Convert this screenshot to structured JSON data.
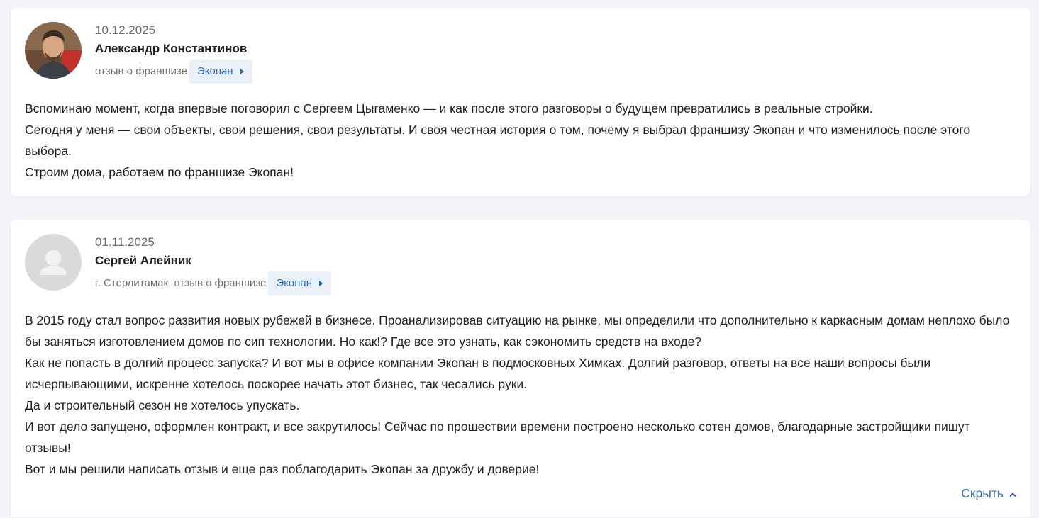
{
  "reviews": [
    {
      "date": "10.12.2025",
      "author": "Александр Константинов",
      "subline": "отзыв о франшизе",
      "brand": "Экопан",
      "paragraphs": [
        "Вспоминаю момент, когда впервые поговорил с Сергеем Цыгаменко — и как после этого разговоры о будущем превратились в реальные стройки.",
        "Сегодня у меня — свои объекты, свои решения, свои результаты. И своя честная история о том, почему я выбрал франшизу Экопан и что изменилось после этого выбора.",
        "Строим дома, работаем по франшизе Экопан!"
      ],
      "avatar_icon": "user-photo"
    },
    {
      "date": "01.11.2025",
      "author": "Сергей Алейник",
      "subline": "г. Стерлитамак, отзыв о франшизе",
      "brand": "Экопан",
      "paragraphs": [
        "В 2015 году стал вопрос развития новых рубежей в бизнесе. Проанализировав ситуацию на рынке, мы определили что дополнительно к каркасным домам неплохо было бы заняться изготовлением домов по сип технологии. Но как!? Где все это узнать, как сэкономить средств на входе?",
        "Как не попасть в долгий процесс запуска? И вот мы в офисе компании Экопан в подмосковных Химках.  Долгий разговор, ответы на все наши вопросы были исчерпывающими, искренне хотелось поскорее начать этот бизнес, так чесались руки.",
        "Да и строительный сезон не хотелось упускать.",
        "И вот дело запущено, оформлен контракт, и все закрутилось! Сейчас по прошествии времени построено  несколько сотен домов, благодарные застройщики пишут отзывы!",
        "Вот и мы решили написать отзыв и еще раз поблагодарить Экопан за дружбу и доверие!"
      ],
      "avatar_icon": "default-user-icon",
      "collapse_label": "Скрыть"
    }
  ],
  "colors": {
    "page_bg": "#f3f5fb",
    "card_bg": "#ffffff",
    "link": "#2a6db3",
    "chip_bg": "#eaf0f7",
    "meta_text": "#6b6b6b"
  }
}
